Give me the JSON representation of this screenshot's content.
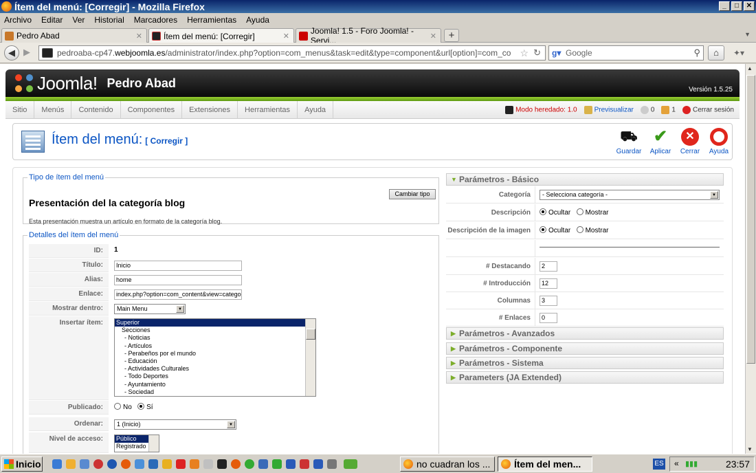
{
  "window": {
    "title": "Ítem del menú: [Corregir] - Mozilla Firefox",
    "minimize": "_",
    "maximize": "□",
    "close": "✕"
  },
  "menubar": [
    "Archivo",
    "Editar",
    "Ver",
    "Historial",
    "Marcadores",
    "Herramientas",
    "Ayuda"
  ],
  "tabs": [
    {
      "label": "Pedro Abad",
      "close": "✕"
    },
    {
      "label": "Ítem del menú: [Corregir]",
      "close": "✕"
    },
    {
      "label": "Joomla! 1.5 - Foro Joomla! - Servi...",
      "close": "✕"
    }
  ],
  "newtab": "+",
  "nav": {
    "url_prefix": "pedroaba-cp47.",
    "url_domain": "webjoomla.es",
    "url_rest": "/administrator/index.php?option=com_menus&task=edit&type=component&url[option]=com_content&u",
    "search_placeholder": "Google"
  },
  "joomla": {
    "logo_text": "Joomla!",
    "site_name": "Pedro Abad",
    "version": "Versión 1.5.25",
    "menu": [
      "Sitio",
      "Menús",
      "Contenido",
      "Componentes",
      "Extensiones",
      "Herramientas",
      "Ayuda"
    ],
    "status": {
      "legacy": "Modo heredado: 1.0",
      "preview": "Previsualizar",
      "messages": "0",
      "users": "1",
      "logout": "Cerrar sesión"
    }
  },
  "toolbar": {
    "title": "Ítem del menú:",
    "subtitle": "[ Corregir ]",
    "buttons": [
      "Guardar",
      "Aplicar",
      "Cerrar",
      "Ayuda"
    ]
  },
  "menu_type": {
    "legend": "Tipo de ítem del menú",
    "title": "Presentación del la categoría blog",
    "description": "Esta presentación muestra un artículo en formato de la categoría blog.",
    "change_button": "Cambiar tipo"
  },
  "details": {
    "legend": "Detalles del ítem del menú",
    "id_label": "ID:",
    "id_value": "1",
    "title_label": "Título:",
    "title_value": "Inicio",
    "alias_label": "Alias:",
    "alias_value": "home",
    "link_label": "Enlace:",
    "link_value": "index.php?option=com_content&view=catego",
    "menu_label": "Mostrar dentro:",
    "menu_value": "Main Menu",
    "parent_label": "Insertar ítem:",
    "parent_items": [
      "Superior",
      "Secciones",
      "- Noticias",
      "- Artículos",
      "- Perabeños por el mundo",
      "- Educación",
      "- Actividades Culturales",
      "- Todo Deportes",
      "- Ayuntamiento",
      "- Sociedad"
    ],
    "published_label": "Publicado:",
    "published_no": "No",
    "published_yes": "Sí",
    "order_label": "Ordenar:",
    "order_value": "1 (Inicio)",
    "access_label": "Nivel de acceso:",
    "access_items": [
      "Público",
      "Registrado"
    ]
  },
  "params": {
    "basic_title": "Parámetros - Básico",
    "category_label": "Categoría",
    "category_value": "- Selecciona categoría -",
    "description_label": "Descripción",
    "image_desc_label": "Descripción de la imagen",
    "hide": "Ocultar",
    "show": "Mostrar",
    "leading_label": "# Destacando",
    "leading_value": "2",
    "intro_label": "# Introducción",
    "intro_value": "12",
    "columns_label": "Columnas",
    "columns_value": "3",
    "links_label": "# Enlaces",
    "links_value": "0",
    "advanced": "Parámetros - Avanzados",
    "component": "Parámetros - Componente",
    "system": "Parámetros - Sistema",
    "ja": "Parameters (JA Extended)"
  },
  "taskbar": {
    "start": "Inicio",
    "items": [
      "no cuadran los ...",
      "Ítem del men..."
    ],
    "lang": "ES",
    "clock": "23:57"
  }
}
